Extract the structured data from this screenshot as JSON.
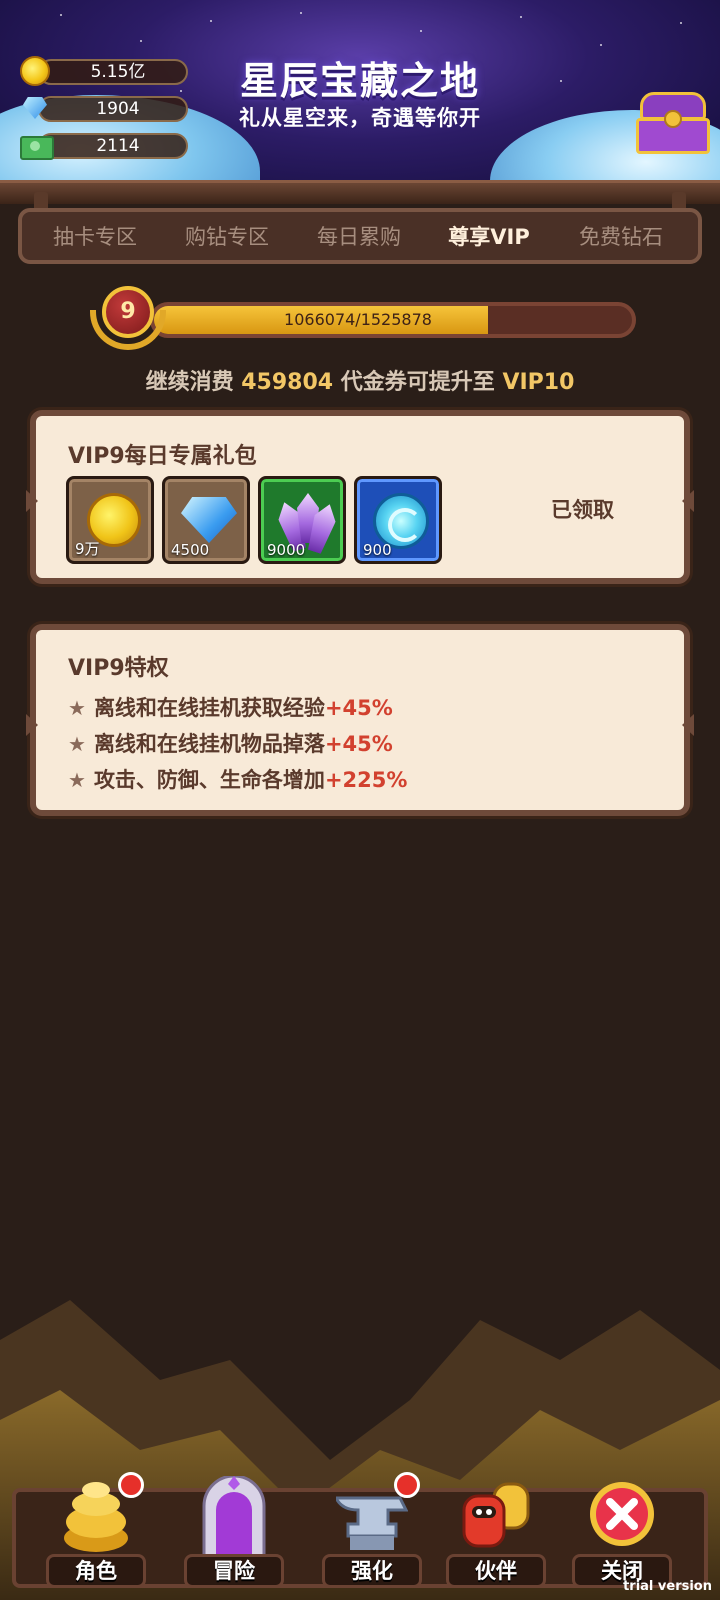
{
  "header": {
    "title": "星辰宝藏之地",
    "subtitle": "礼从星空来，奇遇等你开"
  },
  "currencies": [
    {
      "icon": "coin-icon",
      "value": "5.15亿"
    },
    {
      "icon": "diamond-icon",
      "value": "1904"
    },
    {
      "icon": "cash-icon",
      "value": "2114"
    }
  ],
  "tabs": [
    {
      "label": "抽卡专区",
      "active": false
    },
    {
      "label": "购钻专区",
      "active": false
    },
    {
      "label": "每日累购",
      "active": false
    },
    {
      "label": "尊享VIP",
      "active": true
    },
    {
      "label": "免费钻石",
      "active": false
    }
  ],
  "vip": {
    "level": "9",
    "progress_text": "1066074/1525878",
    "progress_fraction": 0.6987,
    "next_prefix": "继续消费",
    "next_amount": "459804",
    "next_mid": "代金券可提升至",
    "next_level": "VIP10"
  },
  "gift": {
    "title": "VIP9每日专属礼包",
    "items": [
      {
        "icon": "gold-coin-icon",
        "qty": "9万",
        "frame": "brown"
      },
      {
        "icon": "diamond-icon",
        "qty": "4500",
        "frame": "brown"
      },
      {
        "icon": "purple-crystal-icon",
        "qty": "9000",
        "frame": "green"
      },
      {
        "icon": "blue-orb-icon",
        "qty": "900",
        "frame": "blue"
      }
    ],
    "status": "已领取"
  },
  "privileges": {
    "title": "VIP9特权",
    "items": [
      {
        "text": "离线和在线挂机获取经验",
        "bonus": "+45%"
      },
      {
        "text": "离线和在线挂机物品掉落",
        "bonus": "+45%"
      },
      {
        "text": "攻击、防御、生命各增加",
        "bonus": "+225%"
      }
    ]
  },
  "nav": [
    {
      "label": "角色",
      "badge": true
    },
    {
      "label": "冒险",
      "badge": false
    },
    {
      "label": "强化",
      "badge": true
    },
    {
      "label": "伙伴",
      "badge": false
    },
    {
      "label": "关闭",
      "badge": false
    }
  ],
  "watermark": "trial version",
  "colors": {
    "accent": "#f2c766",
    "bonus": "#d2412f",
    "panel": "#f8ead8"
  }
}
